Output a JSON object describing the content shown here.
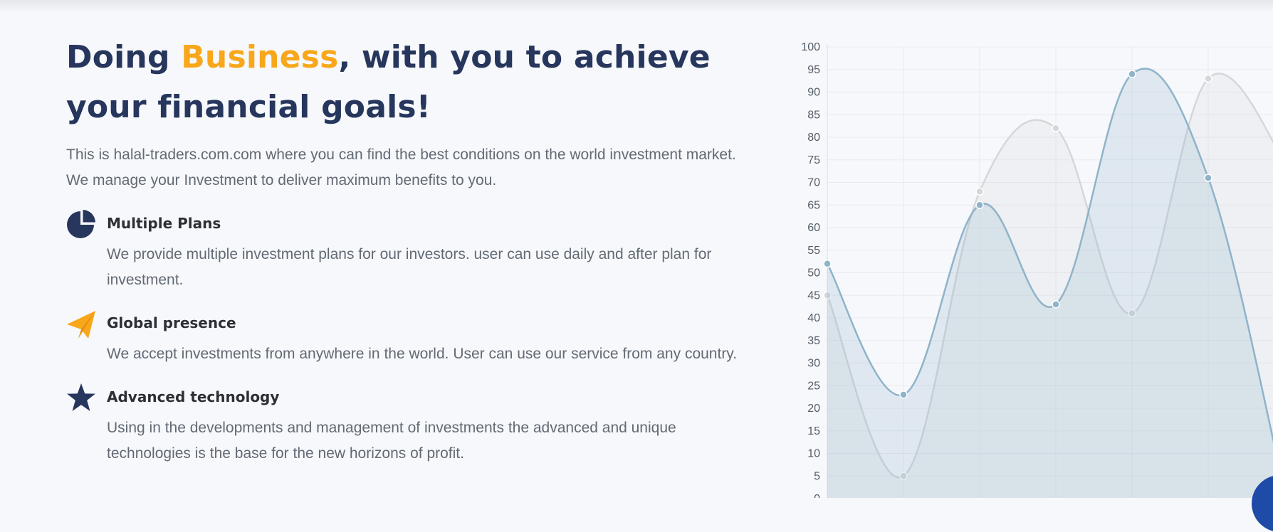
{
  "hero": {
    "title_part1": "Doing ",
    "title_accent": "Business",
    "title_part2": ", with you to achieve your financial goals!",
    "intro": "This is halal-traders.com.com where you can find the best conditions on the world investment market. We manage your Investment to deliver maximum benefits to you."
  },
  "features": [
    {
      "icon": "pie-chart-icon",
      "title": "Multiple Plans",
      "description": "We provide multiple investment plans for our investors. user can use daily and after plan for investment."
    },
    {
      "icon": "paper-plane-icon",
      "title": "Global presence",
      "description": "We accept investments from anywhere in the world. User can use our service from any country."
    },
    {
      "icon": "star-icon",
      "title": "Advanced technology",
      "description": "Using in the developments and management of investments the advanced and unique technologies is the base for the new horizons of profit."
    }
  ],
  "colors": {
    "navy": "#26365c",
    "accent": "#f8a71b",
    "text_muted": "#636a74",
    "series_blue": "#8fb3ca",
    "series_gray": "#d5d7d9"
  },
  "chart_data": {
    "type": "area",
    "x": [
      0,
      1,
      2,
      3,
      4,
      5,
      6
    ],
    "ylim": [
      0,
      100
    ],
    "y_ticks": [
      0,
      5,
      10,
      15,
      20,
      25,
      30,
      35,
      40,
      45,
      50,
      55,
      60,
      65,
      70,
      75,
      80,
      85,
      90,
      95,
      100
    ],
    "grid": true,
    "legend": "none",
    "series": [
      {
        "values": [
          45,
          5,
          68,
          82,
          41,
          93,
          75
        ],
        "color": "#d5d7d9",
        "fill": "rgba(210,212,215,0.22)"
      },
      {
        "values": [
          52,
          23,
          65,
          43,
          94,
          71,
          2
        ],
        "color": "#8fb3ca",
        "fill": "rgba(143,179,202,0.22)"
      }
    ]
  }
}
